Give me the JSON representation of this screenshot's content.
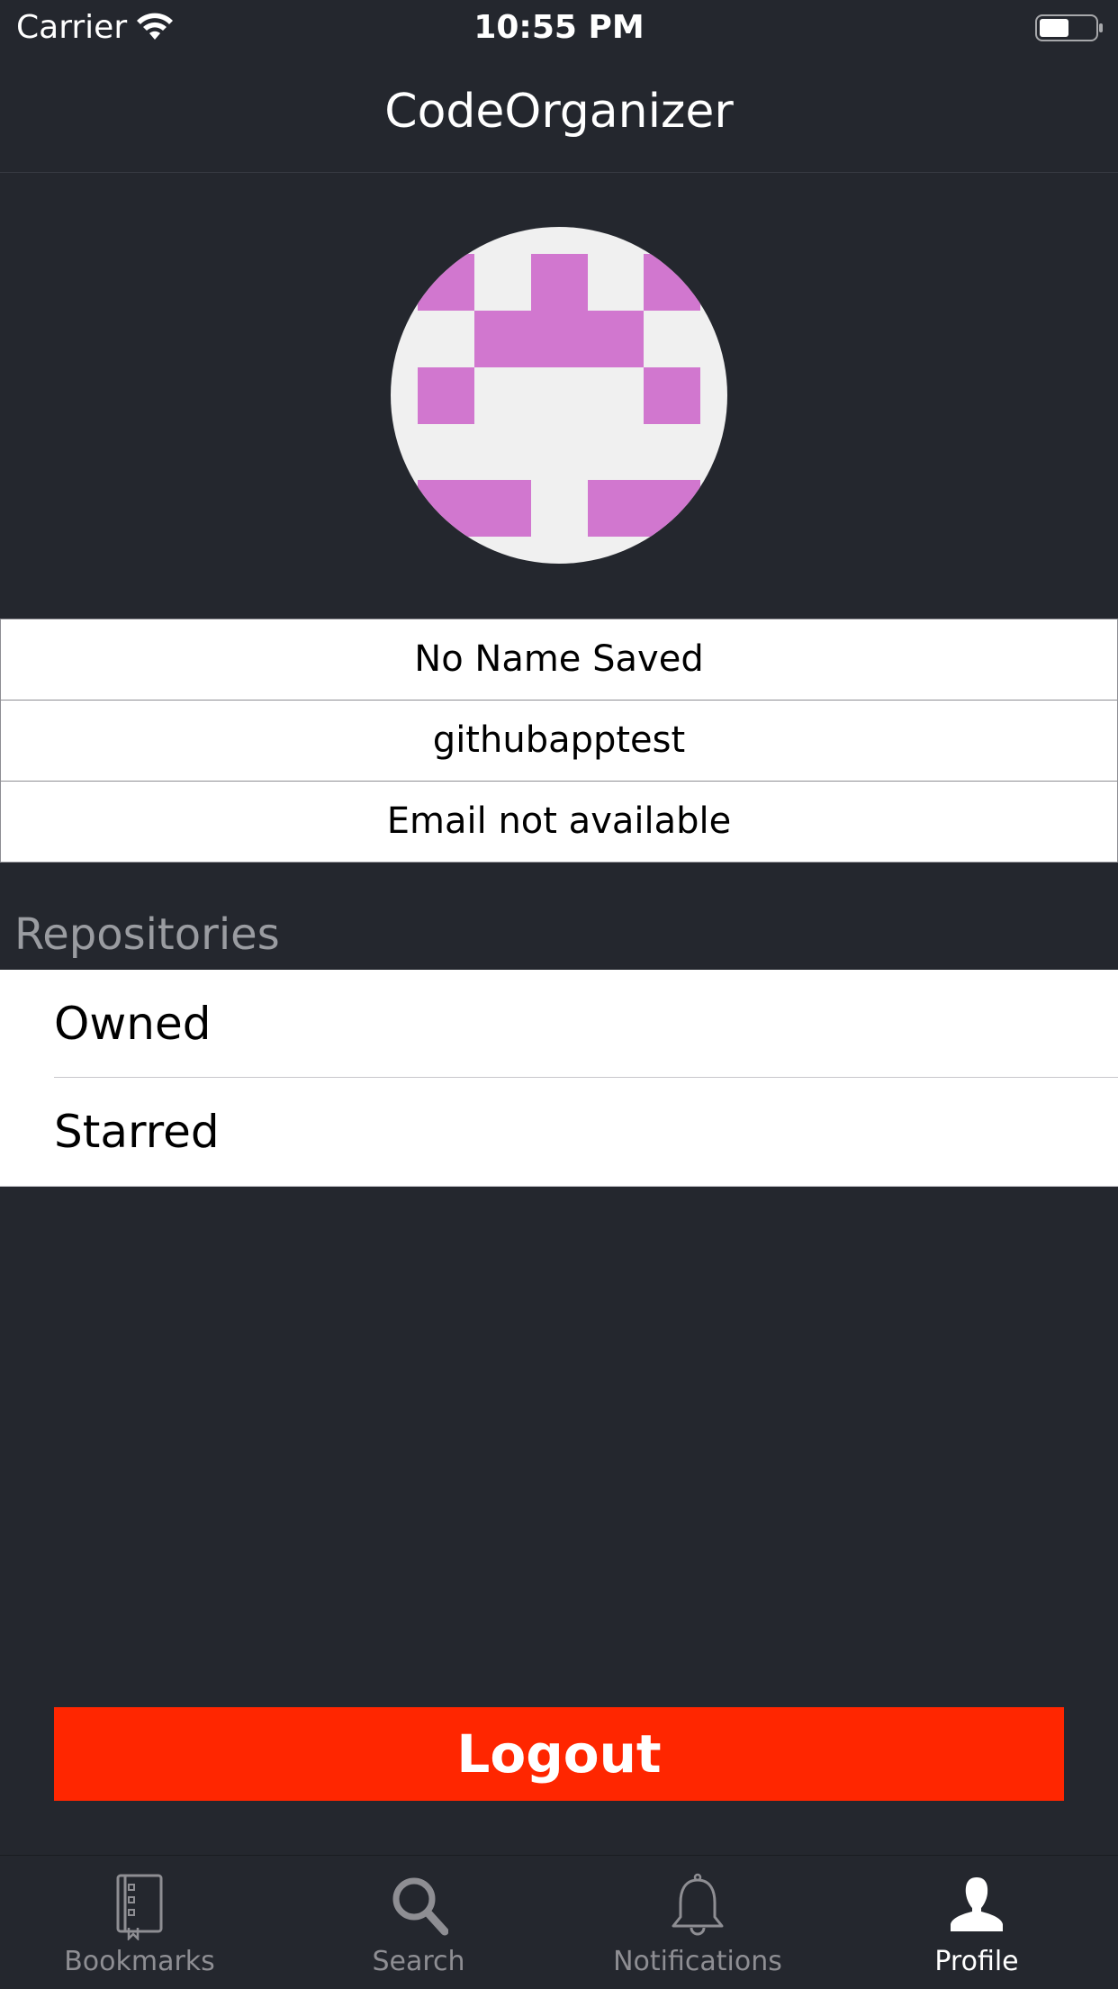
{
  "status_bar": {
    "carrier": "Carrier",
    "time": "10:55 PM"
  },
  "nav": {
    "title": "CodeOrganizer"
  },
  "profile": {
    "name": "No Name Saved",
    "login": "githubapptest",
    "email": "Email not available",
    "avatar_color": "#d177cf",
    "avatar_bg": "#f0f0f0"
  },
  "repositories": {
    "header": "Repositories",
    "items": [
      {
        "label": "Owned"
      },
      {
        "label": "Starred"
      }
    ]
  },
  "logout": {
    "label": "Logout",
    "color": "#ff2600"
  },
  "tab_bar": {
    "items": [
      {
        "label": "Bookmarks",
        "icon": "bookmarks-icon",
        "active": false
      },
      {
        "label": "Search",
        "icon": "search-icon",
        "active": false
      },
      {
        "label": "Notifications",
        "icon": "bell-icon",
        "active": false
      },
      {
        "label": "Profile",
        "icon": "profile-icon",
        "active": true
      }
    ]
  },
  "colors": {
    "background": "#24272e",
    "tab_inactive": "#8e8e93",
    "tab_active": "#ffffff"
  }
}
